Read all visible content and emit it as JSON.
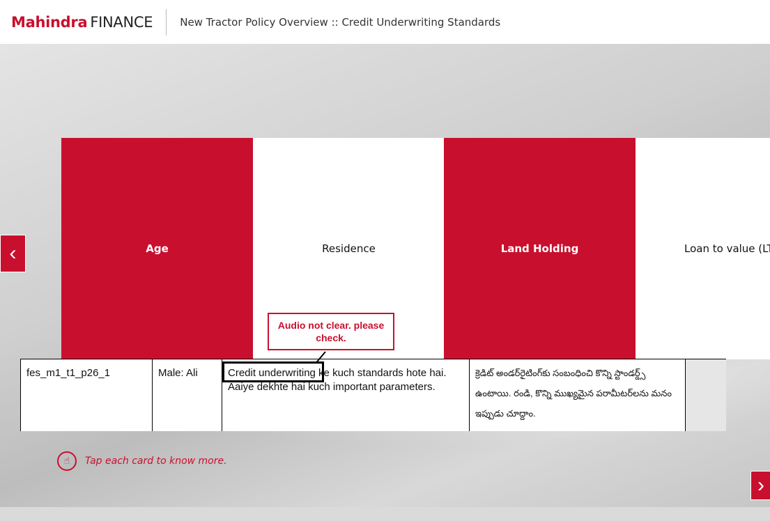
{
  "header": {
    "brand": "Mahindra",
    "brand_suffix": "FINANCE",
    "title": "New Tractor Policy Overview :: Credit Underwriting Standards"
  },
  "cards": [
    {
      "label": "Age"
    },
    {
      "label": "Residence"
    },
    {
      "label": "Land Holding"
    },
    {
      "label": "Loan to value (LTV"
    }
  ],
  "review": {
    "id": "fes_m1_t1_p26_1",
    "speaker": "Male: Ali",
    "script": "Credit underwriting ke kuch standards hote hai. Aaiye dekhte hai kuch important parameters.",
    "translation": "క్రెడిట్ అండర్‌రైటింగ్‌కు సంబంధించి కొన్ని స్టాండర్డ్స్ ఉంటాయి. రండి, కొన్ని ముఖ్యమైన పరామీటర్‌లను మనం ఇప్పుడు చూద్దాం.",
    "comment": "Audio not clear. please check."
  },
  "hint": "Tap each card to know more.",
  "nav": {
    "prev": "‹",
    "next": "›"
  }
}
